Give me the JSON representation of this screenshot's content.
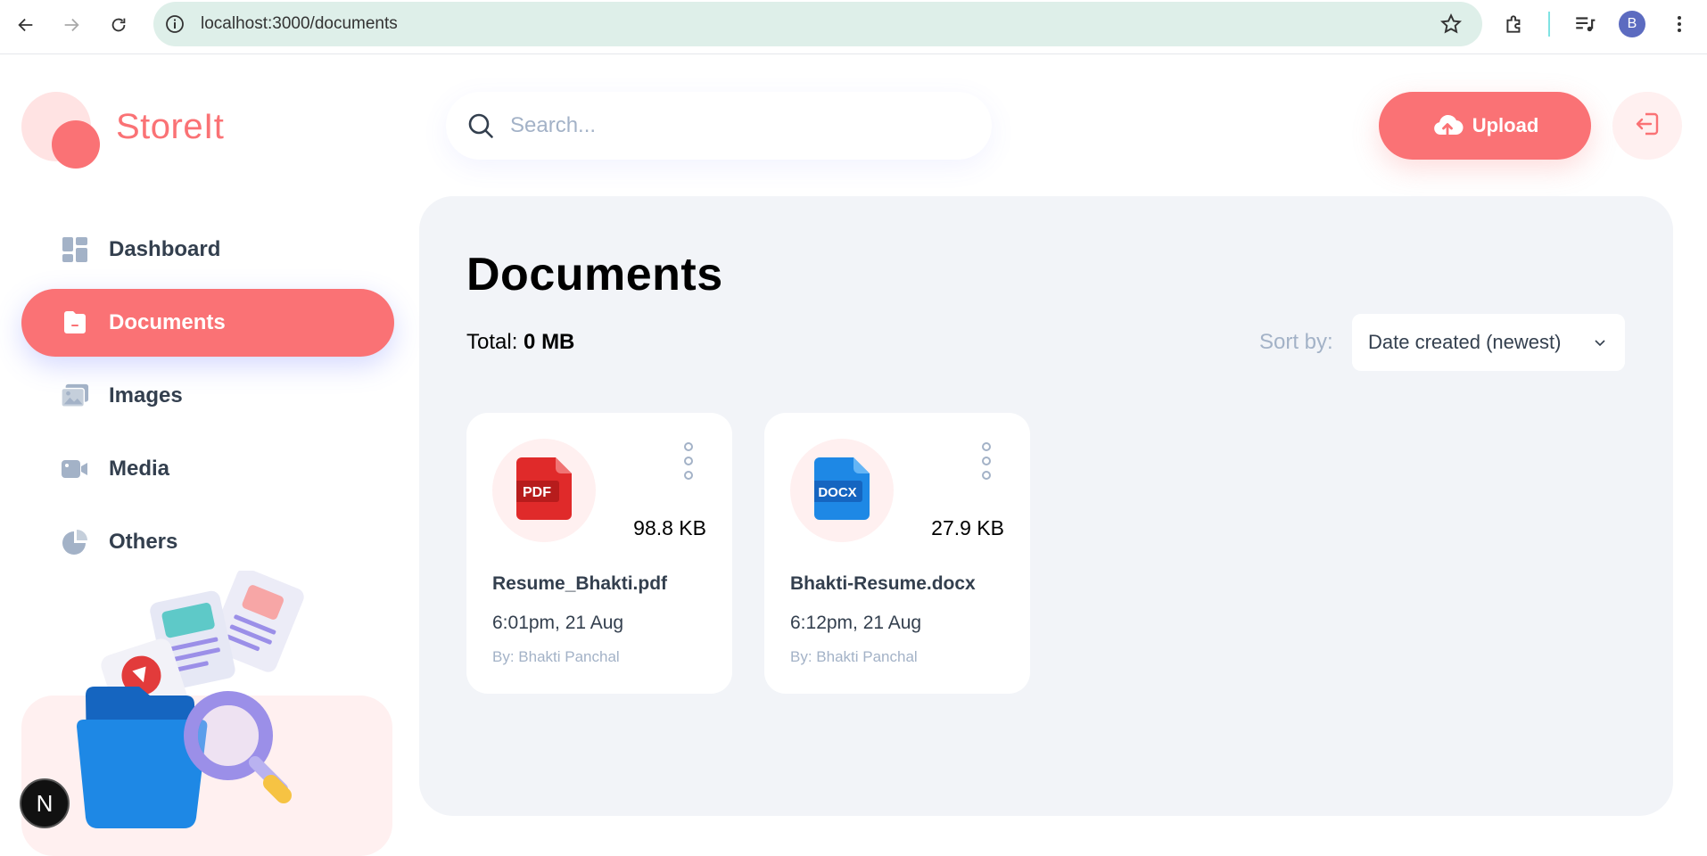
{
  "browser": {
    "url": "localhost:3000/documents",
    "profile_initial": "B",
    "icons": [
      "back-icon",
      "forward-icon",
      "reload-icon",
      "site-info-icon",
      "bookmark-star-icon",
      "extensions-icon",
      "media-queue-icon",
      "more-vert-icon"
    ]
  },
  "brand": {
    "name": "StoreIt",
    "color": "#FA7275"
  },
  "sidebar": {
    "items": [
      {
        "label": "Dashboard",
        "icon": "dashboard-icon",
        "active": false
      },
      {
        "label": "Documents",
        "icon": "documents-icon",
        "active": true
      },
      {
        "label": "Images",
        "icon": "images-icon",
        "active": false
      },
      {
        "label": "Media",
        "icon": "media-icon",
        "active": false
      },
      {
        "label": "Others",
        "icon": "others-icon",
        "active": false
      }
    ],
    "dev_badge": "N"
  },
  "header": {
    "search_placeholder": "Search...",
    "upload_label": "Upload",
    "logout_icon": "logout-icon"
  },
  "main": {
    "title": "Documents",
    "total_label": "Total:",
    "total_value": "0 MB",
    "sort_label": "Sort by:",
    "sort_value": "Date created (newest)",
    "files": [
      {
        "type_label": "PDF",
        "type_color": "#E02A2A",
        "size": "98.8 KB",
        "name": "Resume_Bhakti.pdf",
        "date": "6:01pm, 21 Aug",
        "owner": "By: Bhakti Panchal"
      },
      {
        "type_label": "DOCX",
        "type_color": "#1E88E5",
        "size": "27.9 KB",
        "name": "Bhakti-Resume.docx",
        "date": "6:12pm, 21 Aug",
        "owner": "By: Bhakti Panchal"
      }
    ]
  }
}
